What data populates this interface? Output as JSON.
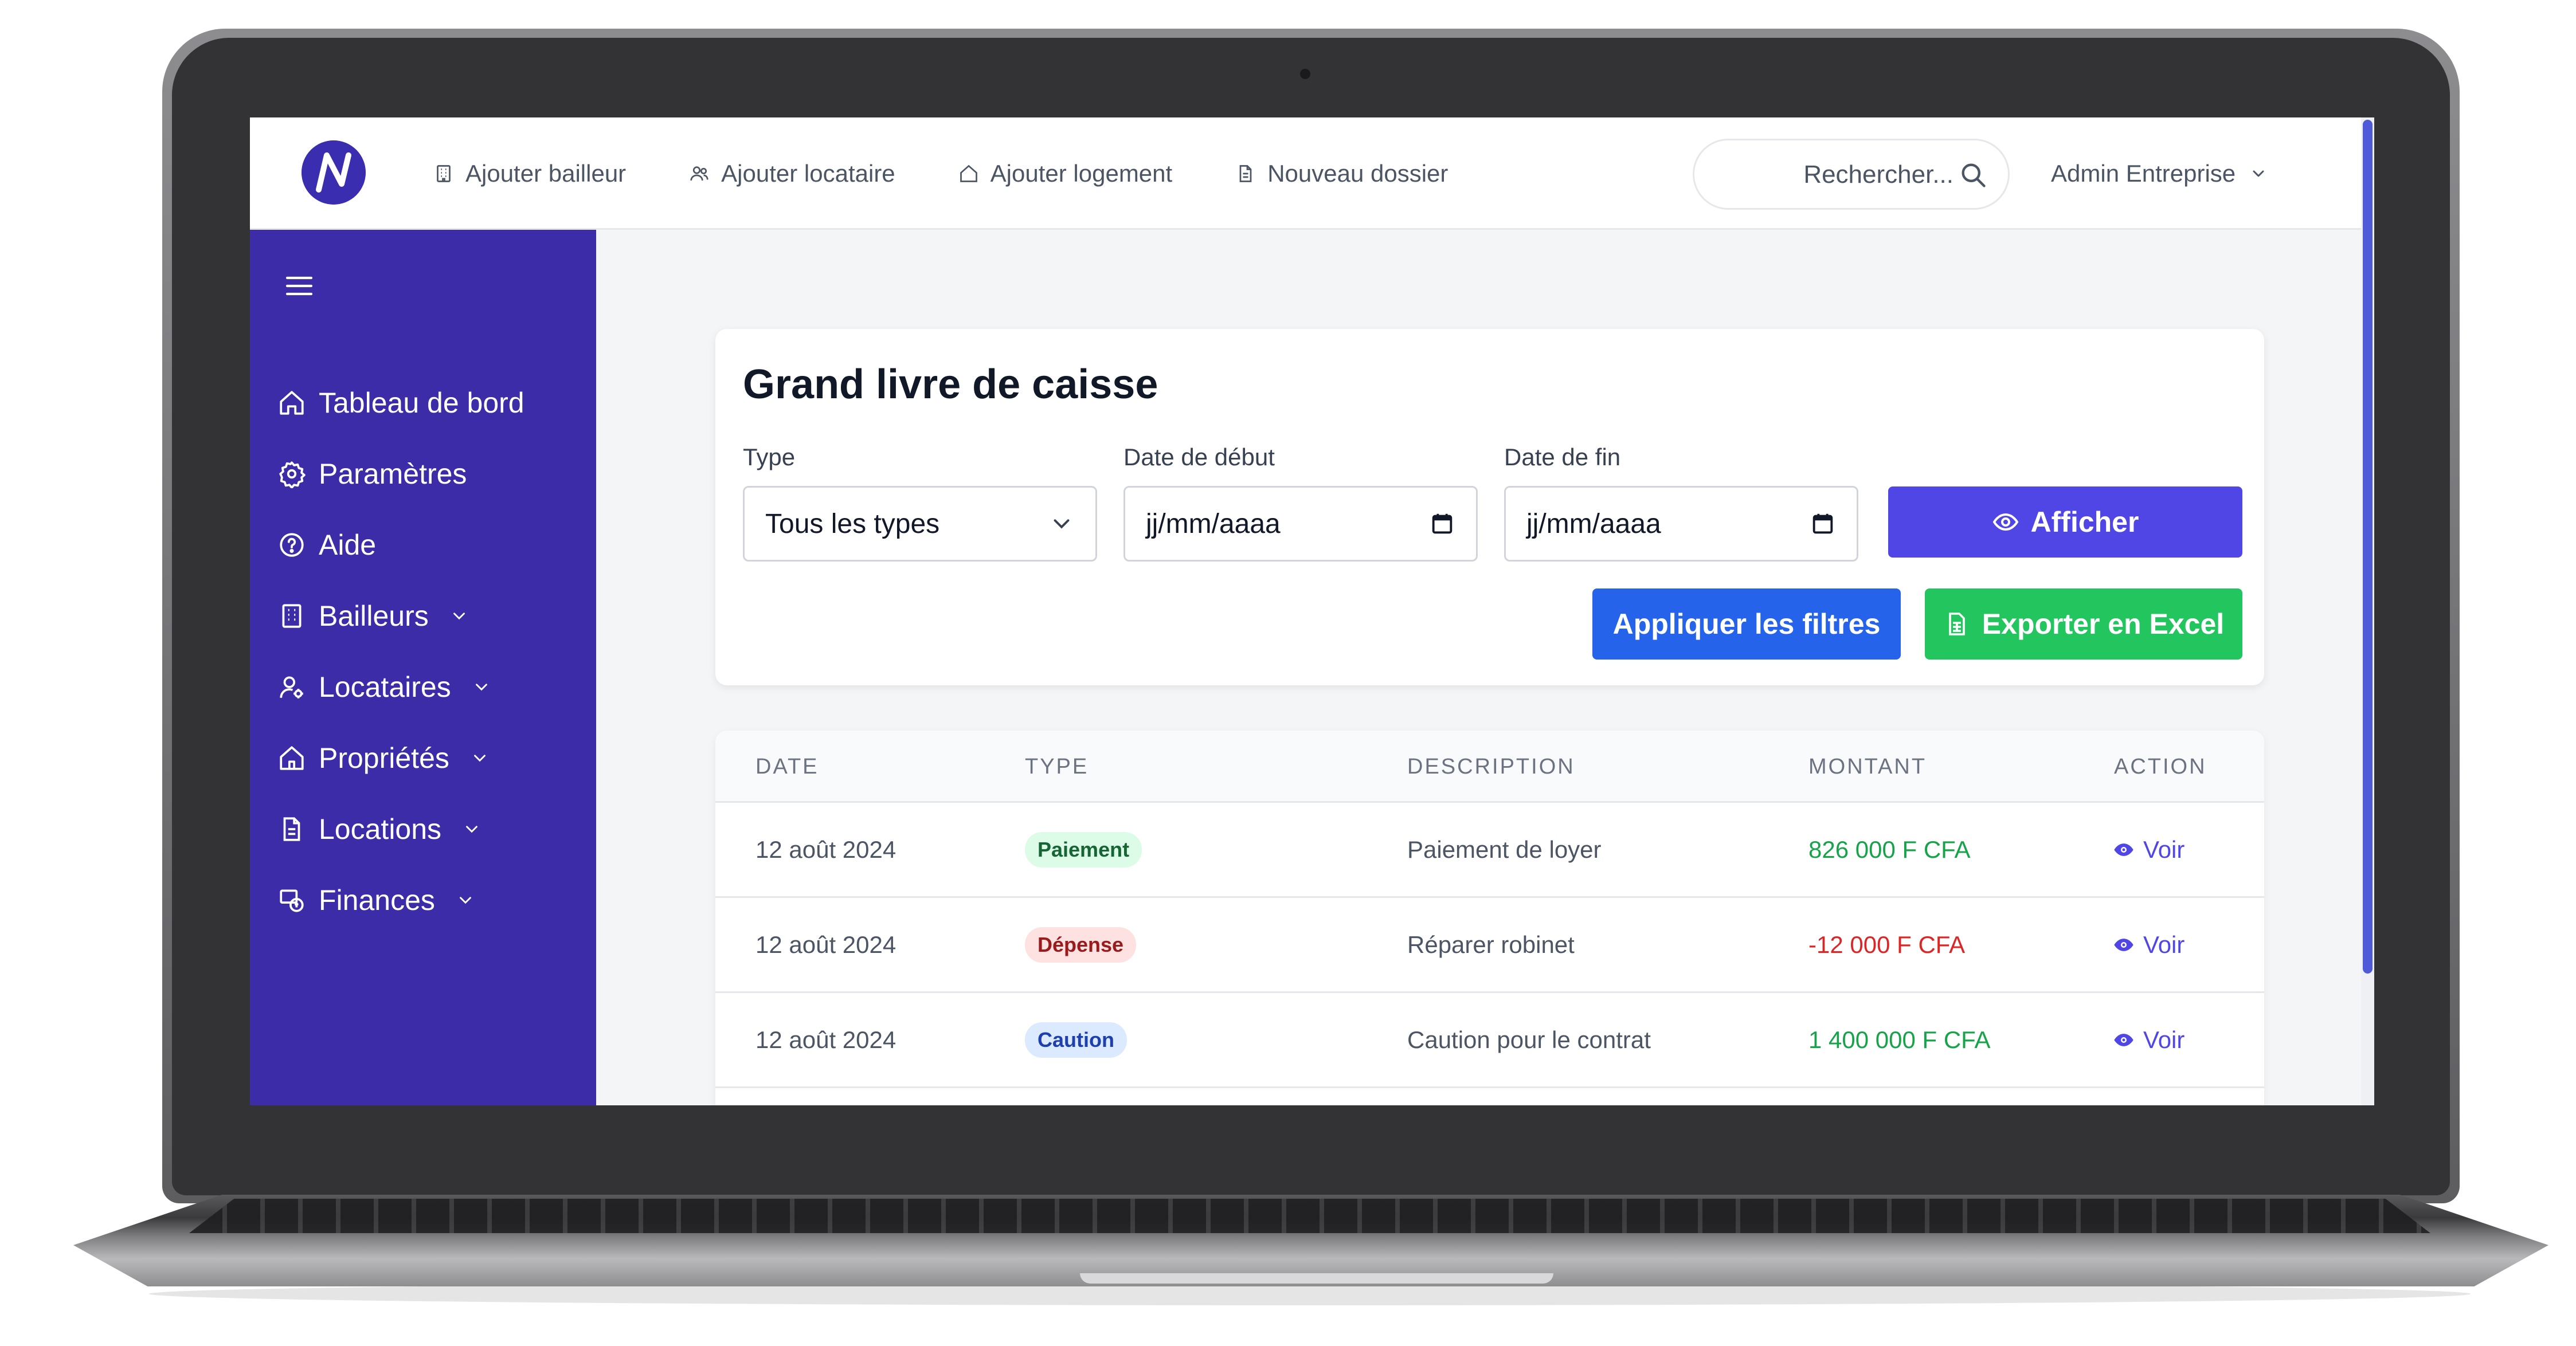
{
  "topbar": {
    "nav": [
      {
        "label": "Ajouter bailleur",
        "icon": "building-icon"
      },
      {
        "label": "Ajouter locataire",
        "icon": "users-icon"
      },
      {
        "label": "Ajouter logement",
        "icon": "home-icon"
      },
      {
        "label": "Nouveau dossier",
        "icon": "file-icon"
      }
    ],
    "search_placeholder": "Rechercher...",
    "user": "Admin Entreprise"
  },
  "sidebar": {
    "items": [
      {
        "label": "Tableau de bord",
        "icon": "home-icon"
      },
      {
        "label": "Paramètres",
        "icon": "gear-icon"
      },
      {
        "label": "Aide",
        "icon": "help-icon"
      },
      {
        "label": "Bailleurs",
        "icon": "building-icon"
      },
      {
        "label": "Locataires",
        "icon": "user-gear-icon"
      },
      {
        "label": "Propriétés",
        "icon": "house-icon"
      },
      {
        "label": "Locations",
        "icon": "document-icon"
      },
      {
        "label": "Finances",
        "icon": "finance-icon"
      }
    ]
  },
  "filters": {
    "title": "Grand livre de caisse",
    "type_label": "Type",
    "type_value": "Tous les types",
    "start_label": "Date de début",
    "start_value": "jj/mm/aaaa",
    "end_label": "Date de fin",
    "end_value": "jj/mm/aaaa",
    "show_button": "Afficher",
    "apply_button": "Appliquer les filtres",
    "export_button": "Exporter en Excel"
  },
  "table": {
    "headers": [
      "DATE",
      "TYPE",
      "DESCRIPTION",
      "MONTANT",
      "ACTION"
    ],
    "rows": [
      {
        "date": "12 août 2024",
        "type": "Paiement",
        "description": "Paiement de loyer",
        "amount": "826 000 F CFA",
        "action": "Voir"
      },
      {
        "date": "12 août 2024",
        "type": "Dépense",
        "description": "Réparer robinet",
        "amount": "-12 000 F CFA",
        "action": "Voir"
      },
      {
        "date": "12 août 2024",
        "type": "Caution",
        "description": "Caution pour le contrat",
        "amount": "1 400 000 F CFA",
        "action": "Voir"
      }
    ]
  },
  "colors": {
    "sidebar": "#3c2ca8",
    "primary": "#4f46e5",
    "blue": "#2563eb",
    "green": "#22c55e"
  }
}
